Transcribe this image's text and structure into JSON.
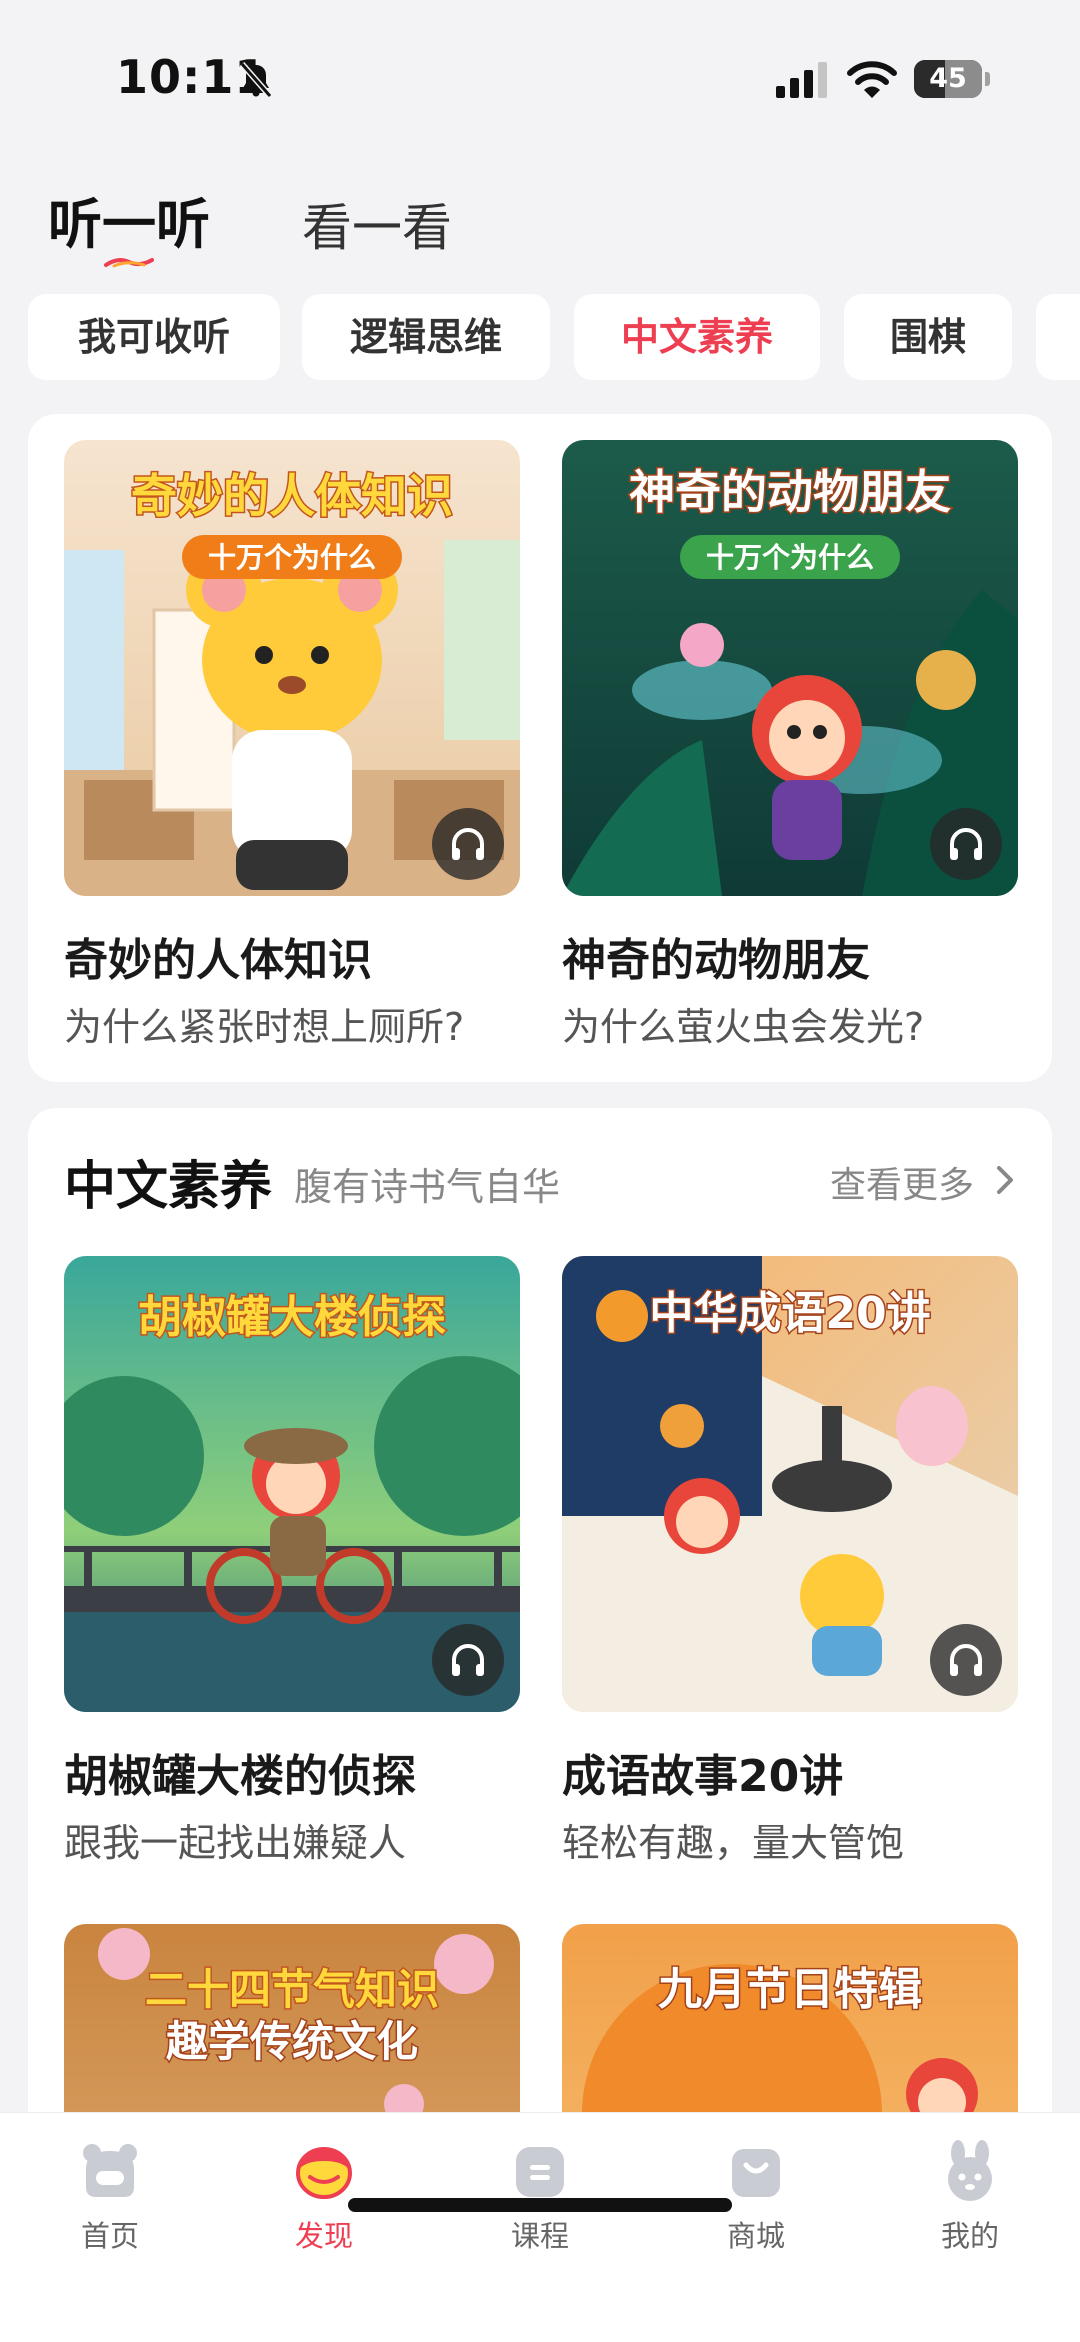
{
  "status_bar": {
    "time": "10:11",
    "battery": "45",
    "battery_level": 0.45
  },
  "top_tabs": [
    {
      "label": "听一听",
      "active": true
    },
    {
      "label": "看一看",
      "active": false
    }
  ],
  "chips": [
    {
      "label": "我可收听",
      "active": false
    },
    {
      "label": "逻辑思维",
      "active": false
    },
    {
      "label": "中文素养",
      "active": true
    },
    {
      "label": "围棋",
      "active": false
    }
  ],
  "featured": [
    {
      "title": "奇妙的人体知识",
      "subtitle": "为什么紧张时想上厕所?",
      "cover_title": "奇妙的人体知识",
      "cover_tag": "十万个为什么",
      "icon": "headphones-icon"
    },
    {
      "title": "神奇的动物朋友",
      "subtitle": "为什么萤火虫会发光?",
      "cover_title": "神奇的动物朋友",
      "cover_tag": "十万个为什么",
      "icon": "headphones-icon"
    }
  ],
  "section": {
    "title": "中文素养",
    "subtitle": "腹有诗书气自华",
    "more": "查看更多",
    "items": [
      {
        "title": "胡椒罐大楼的侦探",
        "subtitle": "跟我一起找出嫌疑人",
        "cover_title": "胡椒罐大楼侦探"
      },
      {
        "title": "成语故事20讲",
        "subtitle": "轻松有趣，量大管饱",
        "cover_title": "中华成语20讲"
      },
      {
        "cover_title_line1": "二十四节气知识",
        "cover_title_line2": "趣学传统文化"
      },
      {
        "cover_title": "九月节日特辑"
      }
    ]
  },
  "bottom_nav": [
    {
      "label": "首页",
      "icon": "bear-head-icon",
      "active": false
    },
    {
      "label": "发现",
      "icon": "discover-icon",
      "active": true
    },
    {
      "label": "课程",
      "icon": "course-icon",
      "active": false
    },
    {
      "label": "商城",
      "icon": "shop-bag-icon",
      "active": false
    },
    {
      "label": "我的",
      "icon": "rabbit-head-icon",
      "active": false
    }
  ],
  "colors": {
    "accent": "#ee3f52",
    "background": "#f3f3f5",
    "card": "#ffffff"
  }
}
